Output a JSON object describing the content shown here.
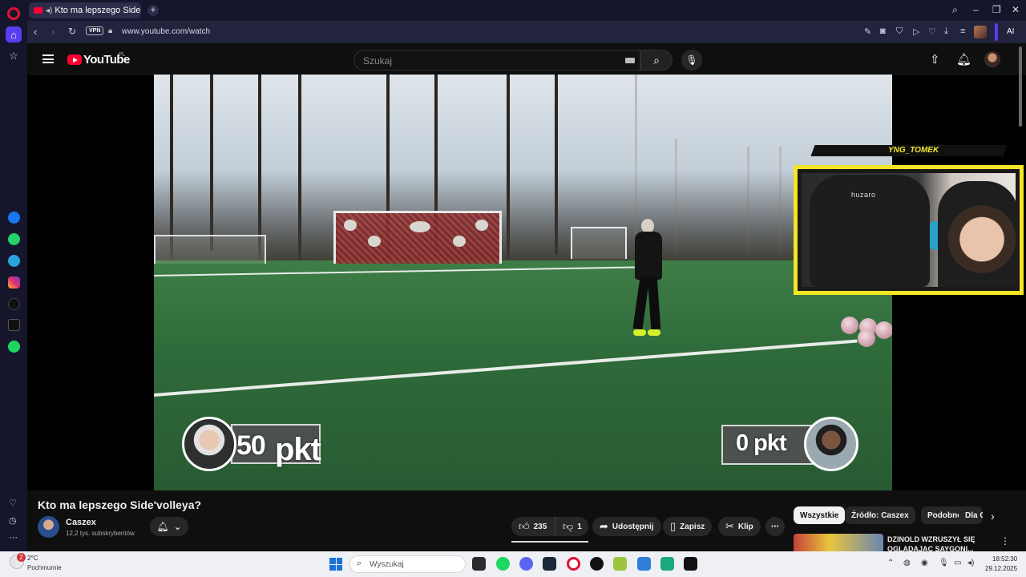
{
  "browser": {
    "tab_title": "Kto ma lepszego Side'volleya? - YouTube",
    "url": "www.youtube.com/watch",
    "vpn_label": "VPN",
    "ai_label": "AI"
  },
  "youtube": {
    "logo_text": "YouTube",
    "region": "PL",
    "search_placeholder": "Szukaj"
  },
  "video": {
    "score_left": "50 pkt",
    "score_left_num": "50",
    "score_left_unit": "pkt",
    "score_right": "0 pkt",
    "webcam_name": "YNG_TOMEK",
    "chair_brand": "huzaro"
  },
  "below": {
    "title": "Kto ma lepszego Side'volleya?",
    "channel": "Caszex",
    "subscribers": "12,2 tys. subskrybentów",
    "likes": "235",
    "dislikes": "1",
    "share_label": "Udostępnij",
    "save_label": "Zapisz",
    "clip_label": "Klip",
    "chips": [
      "Wszystkie",
      "Źródło: Caszex",
      "Podobne",
      "Dla Ciebie"
    ],
    "rec_title": "DZINOLD WZRUSZYŁ SIĘ OGLĄDAJĄC SAYGONI..."
  },
  "taskbar": {
    "weather_temp": "2°C",
    "weather_cond": "Pochmurnie",
    "weather_badge": "2",
    "search_placeholder": "Wyszukaj",
    "time": "18:52:30",
    "date": "29.12.2025"
  },
  "colors": {
    "opera_bg": "#15162b",
    "accent": "#5a3df0",
    "yt_red": "#ff0033",
    "overlay_yellow": "#f4e526"
  }
}
